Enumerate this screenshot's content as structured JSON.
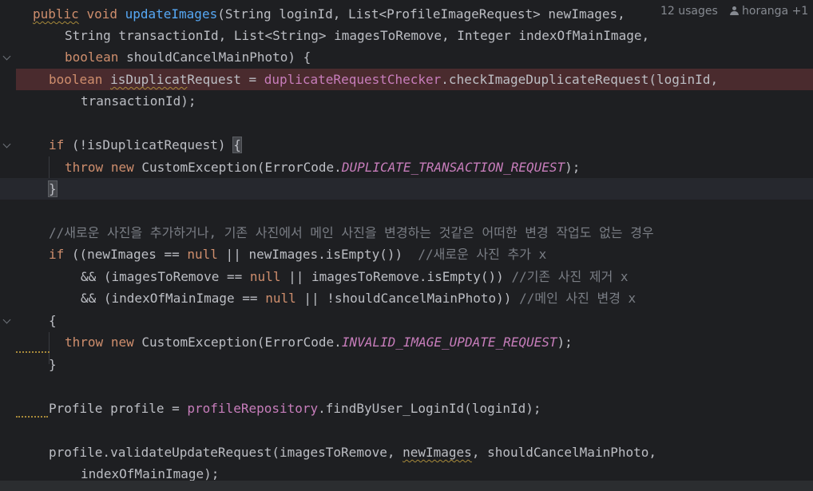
{
  "editor": {
    "inlay": {
      "usages": "12 usages",
      "author": "horanga",
      "author_extra": "+1"
    },
    "lines": {
      "l1": {
        "a": "public",
        "b": " ",
        "c": "void",
        "d": " ",
        "e": "updateImages",
        "f": "(String loginId, List<ProfileImageRequest> newImages,"
      },
      "l2": {
        "a": "String transactionId, List<String> imagesToRemove, Integer indexOfMainImage,"
      },
      "l3": {
        "a": "boolean",
        "b": " shouldCancelMainPhoto) {"
      },
      "l4": {
        "a": "boolean",
        "b": " ",
        "c": "isDuplicat",
        "d": "Request = ",
        "e": "duplicateRequestChecker",
        "f": ".checkImageDuplicateRequest(loginId,"
      },
      "l5": {
        "a": "transactionId);"
      },
      "l6": {
        "a": "if",
        "b": " (!isDuplicatRequest) ",
        "c": "{"
      },
      "l7": {
        "a": "throw",
        "b": " ",
        "c": "new",
        "d": " CustomException(ErrorCode.",
        "e": "DUPLICATE_TRANSACTION_REQUEST",
        "f": ");"
      },
      "l8": {
        "a": "}"
      },
      "l9": {
        "a": "//새로운 사진을 추가하거나, 기존 사진에서 메인 사진을 변경하는 것같은 어떠한 변경 작업도 없는 경우"
      },
      "l10": {
        "a": "if",
        "b": " ((newImages == ",
        "c": "null",
        "d": " || newImages.isEmpty())  ",
        "e": "//새로운 사진 추가 x"
      },
      "l11": {
        "a": "&& (imagesToRemove == ",
        "b": "null",
        "c": " || imagesToRemove.isEmpty()) ",
        "d": "//기존 사진 제거 x"
      },
      "l12": {
        "a": "&& (indexOfMainImage == ",
        "b": "null",
        "c": " || !shouldCancelMainPhoto)) ",
        "d": "//메인 사진 변경 x"
      },
      "l13": {
        "a": "{"
      },
      "l14": {
        "a": "throw",
        "b": " ",
        "c": "new",
        "d": " CustomException(ErrorCode.",
        "e": "INVALID_IMAGE_UPDATE_REQUEST",
        "f": ");"
      },
      "l15": {
        "a": "}"
      },
      "l16": {
        "a": "Profile profile = ",
        "b": "profileRepository",
        "c": ".findByUser_LoginId(loginId);"
      },
      "l17": {
        "a": "profile.validateUpdateRequest(imagesToRemove, ",
        "b": "newImages",
        "c": ", shouldCancelMainPhoto,"
      },
      "l18": {
        "a": "indexOfMainImage);"
      }
    }
  },
  "colors": {
    "background": "#1e1f22",
    "keyword": "#cf8e6d",
    "method_declaration": "#56a8f5",
    "field": "#c77dbb",
    "comment": "#7a7e85",
    "default_text": "#bcbec4",
    "error_line": "#4a2b2e"
  }
}
